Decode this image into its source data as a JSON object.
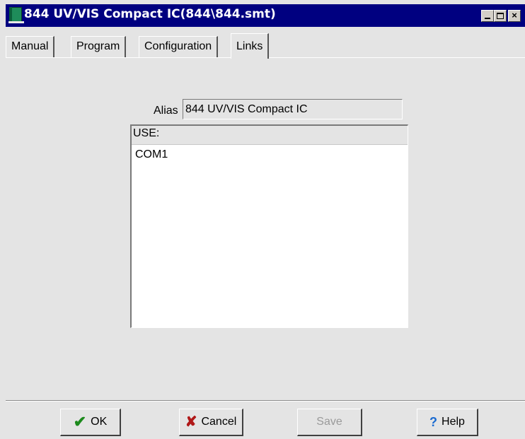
{
  "window": {
    "title": "844 UV/VIS Compact IC(844\\844.smt)"
  },
  "titlebar_buttons": {
    "close_glyph": "×"
  },
  "tabs": [
    {
      "label": "Manual"
    },
    {
      "label": "Program"
    },
    {
      "label": "Configuration"
    },
    {
      "label": "Links",
      "active": true
    }
  ],
  "links": {
    "alias_label": "Alias",
    "alias_value": "844 UV/VIS Compact IC",
    "list_header": "USE:",
    "items": [
      "COM1"
    ]
  },
  "buttons": {
    "ok": "OK",
    "cancel": "Cancel",
    "save": "Save",
    "help": "Help"
  },
  "icons": {
    "ok": "checkmark-icon",
    "cancel": "x-icon",
    "help": "question-icon"
  },
  "colors": {
    "titlebar": "#000080",
    "window_bg": "#e4e4e4",
    "check_green": "#1c8a1c",
    "cancel_red": "#b01818",
    "help_blue": "#1a6ad0"
  }
}
